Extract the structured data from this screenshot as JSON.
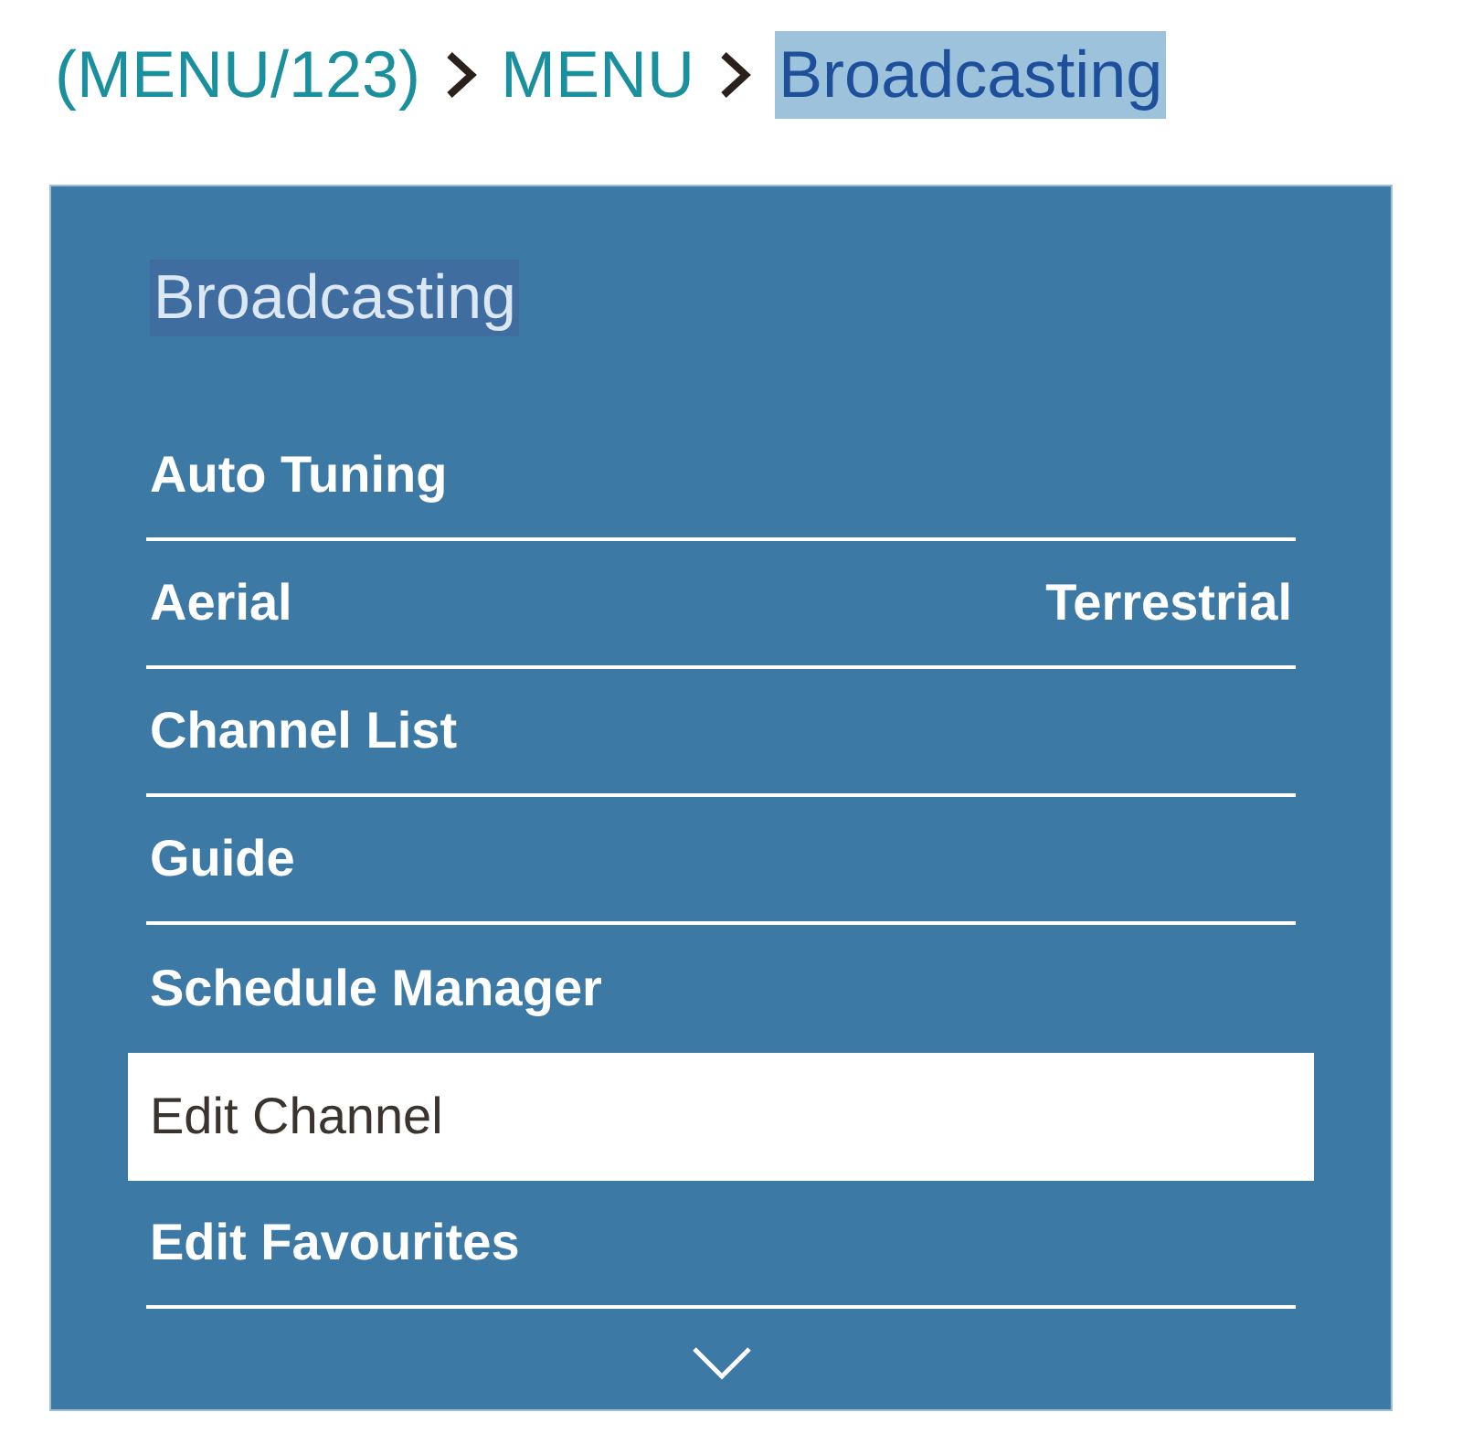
{
  "breadcrumb": [
    {
      "label": "(MENU/123)",
      "selected": false
    },
    {
      "label": "MENU",
      "selected": false
    },
    {
      "label": "Broadcasting",
      "selected": true
    }
  ],
  "menu": {
    "title": "Broadcasting",
    "items": [
      {
        "label": "Auto Tuning",
        "selected": false
      },
      {
        "label": "Aerial",
        "value": "Terrestrial",
        "selected": false
      },
      {
        "label": "Channel List",
        "selected": false
      },
      {
        "label": "Guide",
        "selected": false
      },
      {
        "label": "Schedule Manager",
        "selected": false
      },
      {
        "label": "Edit Channel",
        "selected": true
      },
      {
        "label": "Edit Favourites",
        "selected": false
      }
    ]
  }
}
